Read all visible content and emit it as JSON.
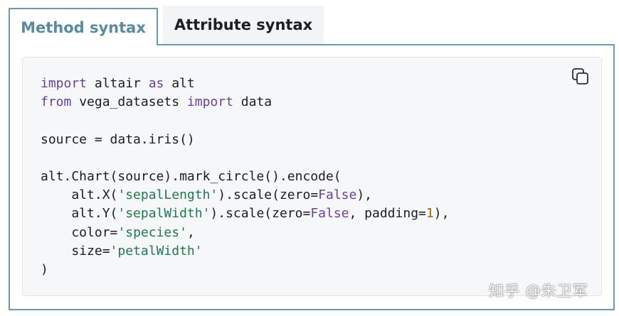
{
  "tabs": [
    {
      "label": "Method syntax",
      "active": true
    },
    {
      "label": "Attribute syntax",
      "active": false
    }
  ],
  "code": {
    "language": "python",
    "lines": [
      [
        {
          "t": "import",
          "c": "kw"
        },
        {
          "t": " altair "
        },
        {
          "t": "as",
          "c": "kw"
        },
        {
          "t": " alt"
        }
      ],
      [
        {
          "t": "from",
          "c": "kw"
        },
        {
          "t": " vega_datasets "
        },
        {
          "t": "import",
          "c": "kw"
        },
        {
          "t": " data"
        }
      ],
      [],
      [
        {
          "t": "source "
        },
        {
          "t": "="
        },
        {
          "t": " data.iris()"
        }
      ],
      [],
      [
        {
          "t": "alt.Chart(source).mark_circle().encode("
        }
      ],
      [
        {
          "t": "    alt.X("
        },
        {
          "t": "'sepalLength'",
          "c": "str"
        },
        {
          "t": ").scale(zero"
        },
        {
          "t": "="
        },
        {
          "t": "False",
          "c": "kw"
        },
        {
          "t": "),"
        }
      ],
      [
        {
          "t": "    alt.Y("
        },
        {
          "t": "'sepalWidth'",
          "c": "str"
        },
        {
          "t": ").scale(zero"
        },
        {
          "t": "="
        },
        {
          "t": "False",
          "c": "kw"
        },
        {
          "t": ", padding"
        },
        {
          "t": "="
        },
        {
          "t": "1",
          "c": "num"
        },
        {
          "t": "),"
        }
      ],
      [
        {
          "t": "    color"
        },
        {
          "t": "="
        },
        {
          "t": "'species'",
          "c": "str"
        },
        {
          "t": ","
        }
      ],
      [
        {
          "t": "    size"
        },
        {
          "t": "="
        },
        {
          "t": "'petalWidth'",
          "c": "str"
        }
      ],
      [
        {
          "t": ")"
        }
      ]
    ]
  },
  "copy_button": {
    "icon": "copy-icon"
  },
  "watermark": "知乎 @朱卫军",
  "colors": {
    "accent_border": "#6b99ad",
    "active_tab_text": "#5a8aa0",
    "keyword": "#6a3fa0",
    "string": "#20794d",
    "number": "#b15d00",
    "code_bg": "#f6f7f8"
  }
}
